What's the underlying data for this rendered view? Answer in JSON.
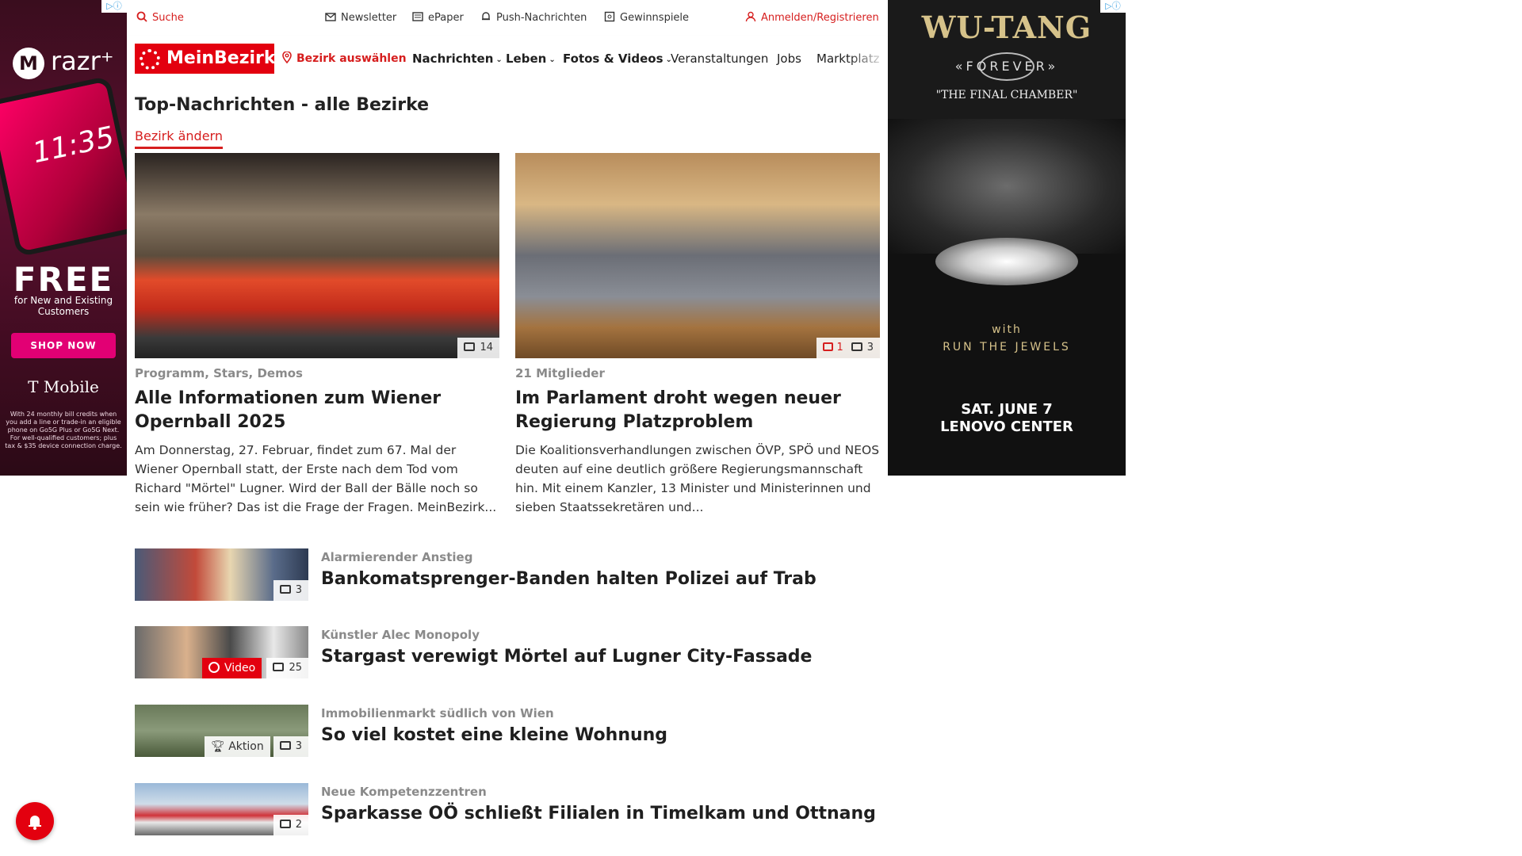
{
  "ads": {
    "left": {
      "brand": "razr⁺",
      "time": "11:35",
      "headline": "FREE",
      "sub": "for New and Existing Customers",
      "cta": "SHOP NOW",
      "carrier": "T Mobile",
      "fine_print": "With 24 monthly bill credits when you add a line or trade-in an eligible phone on Go5G Plus or Go5G Next. For well-qualified customers; plus tax & $35 device connection charge.",
      "badge": "▷ⓘ"
    },
    "right": {
      "title": "WU-TANG",
      "forever": "«FOREVER»",
      "subtitle": "\"THE FINAL CHAMBER\"",
      "with": "with",
      "support": "RUN THE JEWELS",
      "date": "SAT. JUNE 7",
      "venue": "LENOVO CENTER",
      "badge": "▷ⓘ"
    }
  },
  "topbar": {
    "search": "Suche",
    "newsletter": "Newsletter",
    "epaper": "ePaper",
    "push": "Push-Nachrichten",
    "contests": "Gewinnspiele",
    "login": "Anmelden/Registrieren"
  },
  "nav": {
    "logo": "MeinBezirk",
    "district": "Bezirk auswählen",
    "items": [
      "Nachrichten",
      "Leben",
      "Fotos & Videos",
      "Veranstaltungen",
      "Jobs",
      "Marktplatz"
    ]
  },
  "main": {
    "title": "Top-Nachrichten - alle Bezirke",
    "change": "Bezirk ändern",
    "cards": [
      {
        "kicker": "Programm, Stars, Demos",
        "headline": "Alle Informationen zum Wiener Opernball 2025",
        "teaser": "Am Donnerstag, 27. Februar, findet zum 67. Mal der Wiener Opernball statt, der Erste nach dem Tod vom Richard \"Mörtel\" Lugner. Wird der Ball der Bälle noch so sein wie früher? Das ist die Frage der Fragen. MeinBezirk...",
        "photos": "14"
      },
      {
        "kicker": "21 Mitglieder",
        "headline": "Im Parlament droht wegen neuer Regierung Platzproblem",
        "teaser": "Die Koalitionsverhandlungen zwischen ÖVP, SPÖ und NEOS deuten auf eine deutlich größere Regierungsmannschaft hin. Mit einem Kanzler, 13 Minister und Ministerinnen und sieben Staatssekretären und...",
        "comments": "1",
        "photos": "3"
      }
    ],
    "list": [
      {
        "kicker": "Alarmierender Anstieg",
        "title": "Bankomatsprenger-Banden halten Polizei auf Trab",
        "photos": "3"
      },
      {
        "kicker": "Künstler Alec Monopoly",
        "title": "Stargast verewigt Mörtel auf Lugner City-Fassade",
        "video": "Video",
        "photos": "25"
      },
      {
        "kicker": "Immobilienmarkt südlich von Wien",
        "title": "So viel kostet eine kleine Wohnung",
        "aktion": "Aktion",
        "photos": "3"
      },
      {
        "kicker": "Neue Kompetenzzentren",
        "title": "Sparkasse OÖ schließt Filialen in Timelkam und Ottnang",
        "photos": "2"
      }
    ]
  },
  "colors": {
    "brand": "#e3000f",
    "accent": "#d61e1e"
  }
}
